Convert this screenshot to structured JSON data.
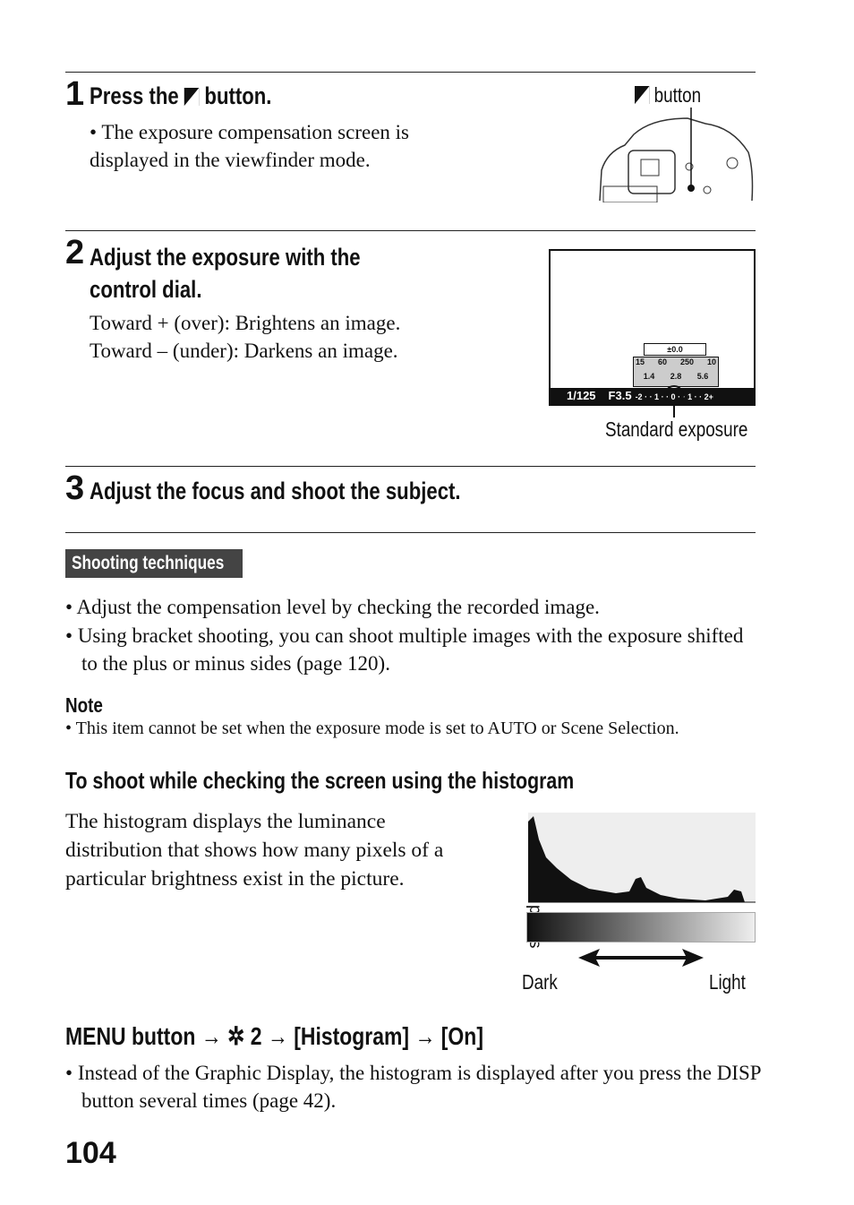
{
  "steps": [
    {
      "number": "1",
      "title_before": "Press the",
      "title_after": "button.",
      "bullet": "The exposure compensation screen is displayed in the viewfinder mode.",
      "figure_label": "button",
      "icon": "exposure-compensation-icon"
    },
    {
      "number": "2",
      "title_line1": "Adjust the exposure with the",
      "title_line2": "control dial.",
      "line1": "Toward + (over): Brightens an image.",
      "line2": "Toward – (under): Darkens an image.",
      "figure_label": "Standard exposure",
      "screen": {
        "shutter": "1/125",
        "aperture": "F3.5",
        "ev_value": "±0.0",
        "scale": "-2 · · 1 · · 0 · · 1 · · 2+",
        "top_scale": [
          "15",
          "60",
          "250",
          "10"
        ],
        "bottom_scale": [
          "1.4",
          "2.8",
          "5.6"
        ]
      }
    },
    {
      "number": "3",
      "title": "Adjust the focus and shoot the subject."
    }
  ],
  "techniques": {
    "label": "Shooting techniques",
    "bullets": [
      "Adjust the compensation level by checking the recorded image.",
      "Using bracket shooting, you can shoot multiple images with the exposure shifted to the plus or minus sides (page 120)."
    ]
  },
  "note": {
    "label": "Note",
    "text": "This item cannot be set when the exposure mode is set to AUTO or Scene Selection."
  },
  "histogram": {
    "heading": "To shoot while checking the screen using the histogram",
    "text": "The histogram displays the luminance distribution that shows how many pixels of a particular brightness exist in the picture.",
    "y_label": "Number of pixels",
    "dark": "Dark",
    "light": "Light"
  },
  "menu": {
    "part1": "MENU button",
    "part2": "2",
    "part3": "[Histogram]",
    "part4": "[On]",
    "arrow": "→",
    "bullet": "Instead of the Graphic Display, the histogram is displayed after you press the DISP button several times (page 42)."
  },
  "page_number": "104"
}
